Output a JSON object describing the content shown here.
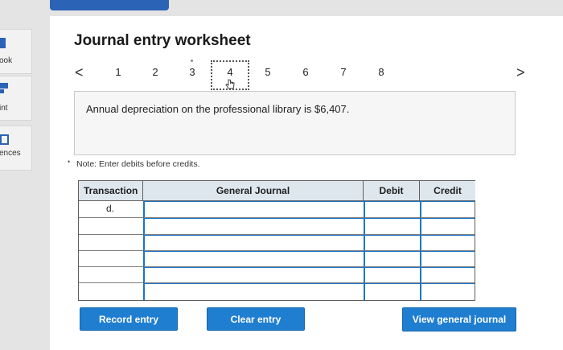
{
  "sidebar": {
    "items": [
      {
        "label": "ook",
        "icon": "book-icon"
      },
      {
        "label": "int",
        "icon": "print-icon"
      },
      {
        "label": "ences",
        "icon": "references-icon"
      }
    ]
  },
  "worksheet": {
    "title": "Journal entry worksheet",
    "prev_arrow": "<",
    "next_arrow": ">",
    "steps": [
      "1",
      "2",
      "3",
      "4",
      "5",
      "6",
      "7",
      "8"
    ],
    "current_step": "4",
    "instruction": "Annual depreciation on the professional library is $6,407.",
    "note": "Note: Enter debits before credits."
  },
  "journal_table": {
    "headers": {
      "transaction": "Transaction",
      "general_journal": "General Journal",
      "debit": "Debit",
      "credit": "Credit"
    },
    "rows": [
      {
        "transaction": "d.",
        "account": "",
        "debit": "",
        "credit": ""
      },
      {
        "transaction": "",
        "account": "",
        "debit": "",
        "credit": ""
      },
      {
        "transaction": "",
        "account": "",
        "debit": "",
        "credit": ""
      },
      {
        "transaction": "",
        "account": "",
        "debit": "",
        "credit": ""
      },
      {
        "transaction": "",
        "account": "",
        "debit": "",
        "credit": ""
      },
      {
        "transaction": "",
        "account": "",
        "debit": "",
        "credit": ""
      }
    ]
  },
  "buttons": {
    "record": "Record entry",
    "clear": "Clear entry",
    "view": "View general journal"
  },
  "colors": {
    "button": "#1f7ed0",
    "header_bg": "#dfe7ee",
    "topbar": "#2b63b6",
    "input_border": "#1877c9"
  }
}
